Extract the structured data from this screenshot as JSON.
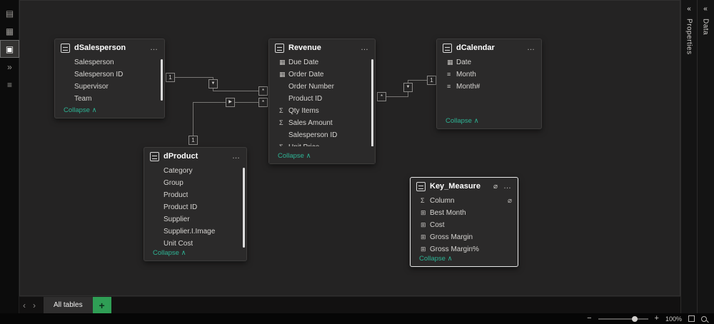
{
  "icons": {
    "sigma": "Σ",
    "calendar": "▦",
    "hier": "≡",
    "calc": "⊞",
    "none": "",
    "eye_hidden": "⌀",
    "more": "…",
    "collapse_chevron": "∧",
    "panel_chevron": "«",
    "tab_prev": "‹",
    "tab_next": "›",
    "minus": "−",
    "plus": "+",
    "add": "+"
  },
  "left_nav": {
    "items": [
      {
        "name": "nav-report-view-button",
        "glyph": "▤"
      },
      {
        "name": "nav-table-view-button",
        "glyph": "▦"
      },
      {
        "name": "nav-model-view-button",
        "glyph": "▣",
        "selected": true
      },
      {
        "name": "nav-dax-query-view-button",
        "glyph": "»"
      },
      {
        "name": "nav-tmdl-view-button",
        "glyph": "≡"
      }
    ]
  },
  "right_panels": {
    "properties": {
      "label": "Properties"
    },
    "data": {
      "label": "Data"
    }
  },
  "ui": {
    "collapse": "Collapse"
  },
  "tables": [
    {
      "name": "dSalesperson",
      "fields": [
        {
          "icon": "none",
          "label": "Salesperson"
        },
        {
          "icon": "none",
          "label": "Salesperson ID"
        },
        {
          "icon": "none",
          "label": "Supervisor"
        },
        {
          "icon": "none",
          "label": "Team"
        }
      ]
    },
    {
      "name": "Revenue",
      "fields": [
        {
          "icon": "calendar",
          "label": "Due Date"
        },
        {
          "icon": "calendar",
          "label": "Order Date"
        },
        {
          "icon": "none",
          "label": "Order Number"
        },
        {
          "icon": "none",
          "label": "Product ID"
        },
        {
          "icon": "sigma",
          "label": "Qty Items"
        },
        {
          "icon": "sigma",
          "label": "Sales Amount"
        },
        {
          "icon": "none",
          "label": "Salesperson ID"
        },
        {
          "icon": "sigma",
          "label": "Unit Price"
        }
      ]
    },
    {
      "name": "dCalendar",
      "fields": [
        {
          "icon": "calendar",
          "label": "Date"
        },
        {
          "icon": "hier",
          "label": "Month"
        },
        {
          "icon": "hier",
          "label": "Month#"
        }
      ]
    },
    {
      "name": "dProduct",
      "fields": [
        {
          "icon": "none",
          "label": "Category"
        },
        {
          "icon": "none",
          "label": "Group"
        },
        {
          "icon": "none",
          "label": "Product"
        },
        {
          "icon": "none",
          "label": "Product ID"
        },
        {
          "icon": "none",
          "label": "Supplier"
        },
        {
          "icon": "none",
          "label": "Supplier.I.Image"
        },
        {
          "icon": "none",
          "label": "Unit Cost"
        }
      ]
    },
    {
      "name": "Key_Measure",
      "fields": [
        {
          "icon": "sigma",
          "label": "Column",
          "hidden": true
        },
        {
          "icon": "calc",
          "label": "Best Month"
        },
        {
          "icon": "calc",
          "label": "Cost"
        },
        {
          "icon": "calc",
          "label": "Gross Margin"
        },
        {
          "icon": "calc",
          "label": "Gross Margin%"
        }
      ]
    }
  ],
  "relationships": {
    "one": "1",
    "many": "*",
    "arrow_down": "▼",
    "arrow_right": "▶"
  },
  "bottom_bar": {
    "active_tab": "All tables"
  },
  "status_bar": {
    "zoom_level": "100%"
  }
}
